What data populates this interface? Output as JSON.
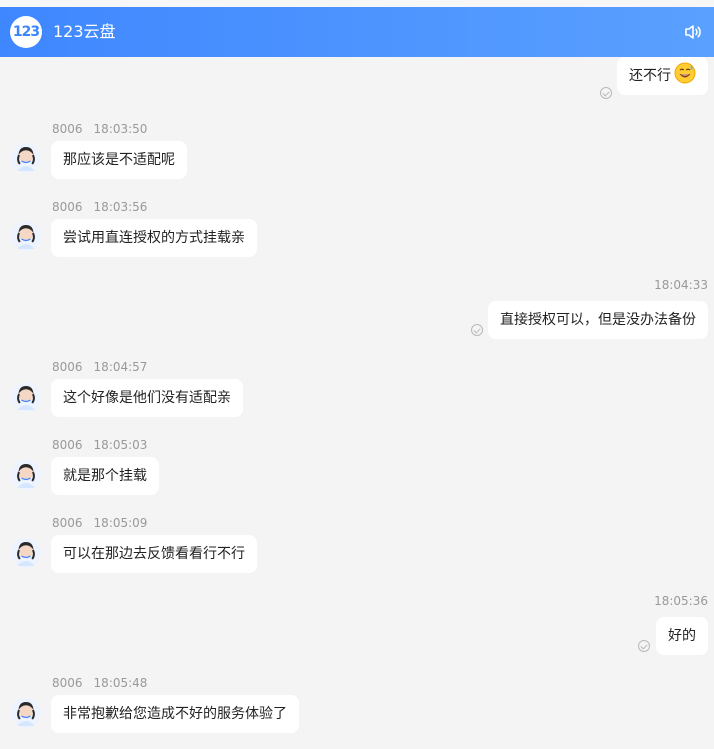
{
  "app": {
    "title": "123云盘",
    "logo_text": "123",
    "icons": {
      "logo": "cloud-drive-logo",
      "sound": "speaker-icon",
      "read_receipt": "check-circle-icon",
      "emoji": "sweat-smile-emoji"
    }
  },
  "messages": [
    {
      "side": "user",
      "text": "还不行",
      "emoji": "😅"
    },
    {
      "side": "agent",
      "agent": "8006",
      "time": "18:03:50",
      "text": "那应该是不适配呢"
    },
    {
      "side": "agent",
      "agent": "8006",
      "time": "18:03:56",
      "text": "尝试用直连授权的方式挂载亲"
    },
    {
      "side": "user",
      "time": "18:04:33",
      "text": "直接授权可以，但是没办法备份"
    },
    {
      "side": "agent",
      "agent": "8006",
      "time": "18:04:57",
      "text": "这个好像是他们没有适配亲"
    },
    {
      "side": "agent",
      "agent": "8006",
      "time": "18:05:03",
      "text": "就是那个挂载"
    },
    {
      "side": "agent",
      "agent": "8006",
      "time": "18:05:09",
      "text": "可以在那边去反馈看看行不行"
    },
    {
      "side": "user",
      "time": "18:05:36",
      "text": "好的"
    },
    {
      "side": "agent",
      "agent": "8006",
      "time": "18:05:48",
      "text": "非常抱歉给您造成不好的服务体验了"
    }
  ]
}
